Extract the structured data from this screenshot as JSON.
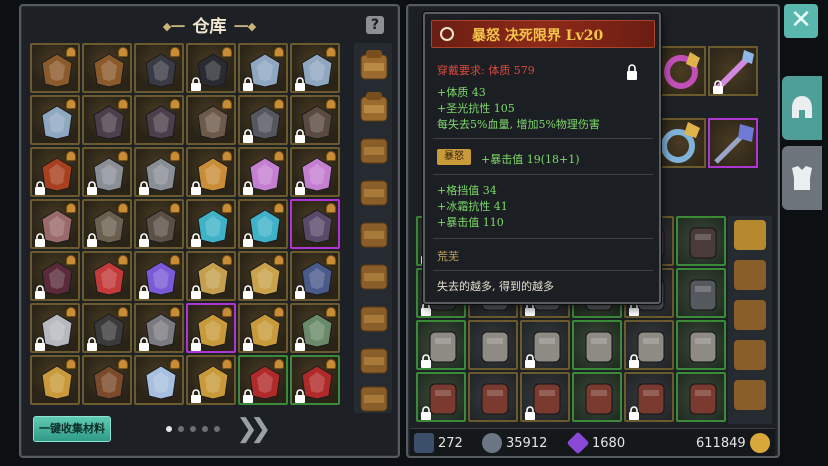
{
  "warehouse": {
    "title": "仓库",
    "help_icon": "question-icon",
    "collect_button": "一键收集材料",
    "pager": {
      "pages": 5,
      "current": 1
    },
    "next_icon": "double-chevron-right-icon",
    "grid": [
      [
        {
          "item": "leather-armor",
          "locked": false
        },
        {
          "item": "leather-armor",
          "locked": false
        },
        {
          "item": "dark-gauntlet",
          "locked": false
        },
        {
          "item": "shadow-gloves",
          "locked": true
        },
        {
          "item": "silver-ring",
          "locked": true
        },
        {
          "item": "silver-ring",
          "locked": true
        }
      ],
      [
        {
          "item": "silver-ring",
          "locked": false
        },
        {
          "item": "dark-staff",
          "locked": false
        },
        {
          "item": "dark-staff",
          "locked": false
        },
        {
          "item": "claw-gauntlet",
          "locked": false
        },
        {
          "item": "iron-armor",
          "locked": true
        },
        {
          "item": "dark-bow",
          "locked": true
        }
      ],
      [
        {
          "item": "red-ring",
          "locked": true
        },
        {
          "item": "twin-axes",
          "locked": true
        },
        {
          "item": "twin-axes",
          "locked": true
        },
        {
          "item": "golden-ring",
          "locked": true
        },
        {
          "item": "crystal-sword",
          "locked": true
        },
        {
          "item": "crystal-sword",
          "locked": true
        }
      ],
      [
        {
          "item": "bone-blade",
          "locked": true
        },
        {
          "item": "robe-armor",
          "locked": true
        },
        {
          "item": "spiked-mace",
          "locked": true
        },
        {
          "item": "cyan-gauntlet",
          "locked": true
        },
        {
          "item": "cyan-gauntlet",
          "locked": true
        },
        {
          "item": "purple-bracer",
          "locked": false,
          "selected": true
        }
      ],
      [
        {
          "item": "dark-helm",
          "locked": true
        },
        {
          "item": "ruby-ring",
          "locked": false
        },
        {
          "item": "amethyst-ring",
          "locked": true
        },
        {
          "item": "golden-boots",
          "locked": true
        },
        {
          "item": "golden-claw",
          "locked": true
        },
        {
          "item": "shadow-claw",
          "locked": true
        }
      ],
      [
        {
          "item": "white-armor",
          "locked": true
        },
        {
          "item": "skull-helm",
          "locked": true
        },
        {
          "item": "horned-helm",
          "locked": true
        },
        {
          "item": "golden-gauntlet",
          "locked": true,
          "selected": true
        },
        {
          "item": "golden-gauntlet",
          "locked": true
        },
        {
          "item": "green-armor",
          "locked": true
        }
      ],
      [
        {
          "item": "golden-gauntlet",
          "locked": false
        },
        {
          "item": "brown-boots",
          "locked": false
        },
        {
          "item": "holy-scepter",
          "locked": false
        },
        {
          "item": "golden-gauntlet",
          "locked": true
        },
        {
          "item": "red-dragon-helm",
          "locked": true,
          "green": true
        },
        {
          "item": "red-dragon-helm",
          "locked": true,
          "green": true
        }
      ]
    ]
  },
  "tooltip": {
    "item_name": "暴怒 决死限界 Lv20",
    "requirement": "穿戴要求: 体质 579",
    "base_stats": [
      "+体质 43",
      "+圣光抗性 105",
      "每失去5%血量, 增加5%物理伤害"
    ],
    "set_badge": "暴怒",
    "set_stat": "+暴击值 19(18+1)",
    "extra_stats": [
      "+格挡值 34",
      "+冰霜抗性 41",
      "+暴击值 110"
    ],
    "quality": "荒芜",
    "flavor": "失去的越多, 得到的越多"
  },
  "resources": {
    "sword_count": "272",
    "helm_count": "35912",
    "crystal_count": "1680",
    "gold_count": "611849"
  },
  "colors": {
    "accent": "#59b7ad",
    "selected_border": "#b036d4",
    "item_name": "#f3c44a",
    "requirement": "#d94a3c",
    "stat": "#7fd86a"
  }
}
